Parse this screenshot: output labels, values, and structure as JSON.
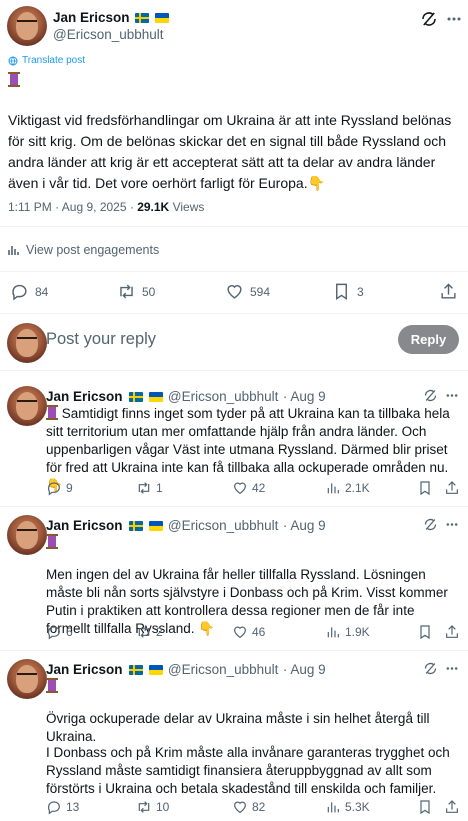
{
  "main_post": {
    "author_name": "Jan Ericson",
    "author_handle": "@Ericson_ubbhult",
    "translate_label": "Translate post",
    "body": "Viktigast vid fredsförhandlingar om Ukraina är att inte Ryssland belönas för sitt krig. Om de belönas skickar det en signal till både Ryssland och andra länder att krig är ett accepterat sätt att ta delar av andra länder även i vår tid. Det vore oerhört farligt för Europa.👇",
    "time": "1:11 PM · Aug 9, 2025 · ",
    "views_count": "29.1K",
    "views_label": "Views",
    "engagements_label": "View post engagements",
    "replies": "84",
    "reposts": "50",
    "likes": "594",
    "bookmarks": "3"
  },
  "compose": {
    "placeholder": "Post your reply",
    "reply_button": "Reply"
  },
  "replies": [
    {
      "author_name": "Jan Ericson",
      "author_handle": "@Ericson_ubbhult",
      "date": "· Aug 9",
      "body": "Samtidigt finns inget som tyder på att Ukraina kan ta tillbaka hela sitt territorium utan mer omfattande hjälp från andra länder. Och uppenbarligen vågar Väst inte utmana Ryssland. Därmed blir priset för fred att Ukraina inte kan få tillbaka alla ockuperade områden nu. 👇",
      "replies": "9",
      "reposts": "1",
      "likes": "42",
      "views": "2.1K"
    },
    {
      "author_name": "Jan Ericson",
      "author_handle": "@Ericson_ubbhult",
      "date": "· Aug 9",
      "body": "Men ingen del av Ukraina får heller tillfalla Ryssland. Lösningen måste bli nån sorts självstyre i Donbass och på Krim. Visst kommer Putin i praktiken att kontrollera dessa regioner men de får inte formellt tillfalla Ryssland. 👇",
      "replies": "6",
      "reposts": "2",
      "likes": "46",
      "views": "1.9K"
    },
    {
      "author_name": "Jan Ericson",
      "author_handle": "@Ericson_ubbhult",
      "date": "· Aug 9",
      "body_p1": "Övriga ockuperade delar av Ukraina måste i sin helhet återgå till Ukraina.",
      "body_p2": "I Donbass och på Krim måste alla invånare garanteras trygghet och Ryssland måste samtidigt finansiera återuppbyggnad av allt som förstörts i Ukraina och betala skadestånd till enskilda och familjer.",
      "replies": "13",
      "reposts": "10",
      "likes": "82",
      "views": "5.3K"
    }
  ],
  "icons": {
    "grok": "grok-icon",
    "more": "more-icon",
    "reply": "reply-icon",
    "repost": "repost-icon",
    "like": "heart-icon",
    "bookmark": "bookmark-icon",
    "share": "share-icon",
    "views": "analytics-icon"
  },
  "colors": {
    "accent": "#1d9bf0",
    "muted": "#536471",
    "reply_button_bg": "#87898c"
  }
}
